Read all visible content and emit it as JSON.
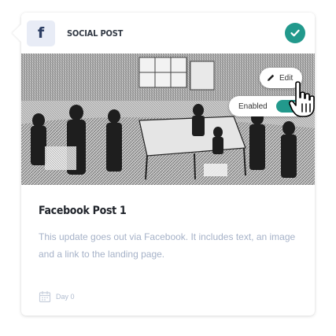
{
  "card": {
    "type_label": "SOCIAL POST",
    "network_icon": "facebook-icon",
    "status_icon": "check-circle-icon",
    "title": "Facebook Post 1",
    "description": "This update goes out via Facebook. It includes text, an image and a link to the landing page.",
    "day_label": "Day 0",
    "day_icon": "calendar-icon"
  },
  "controls": {
    "edit_label": "Edit",
    "enabled_label": "Enabled",
    "enabled": true
  },
  "colors": {
    "accent": "#22998c",
    "title_text": "#1f232a",
    "muted_text": "#a6b2c8",
    "icon_bg": "#e8ecf6"
  }
}
